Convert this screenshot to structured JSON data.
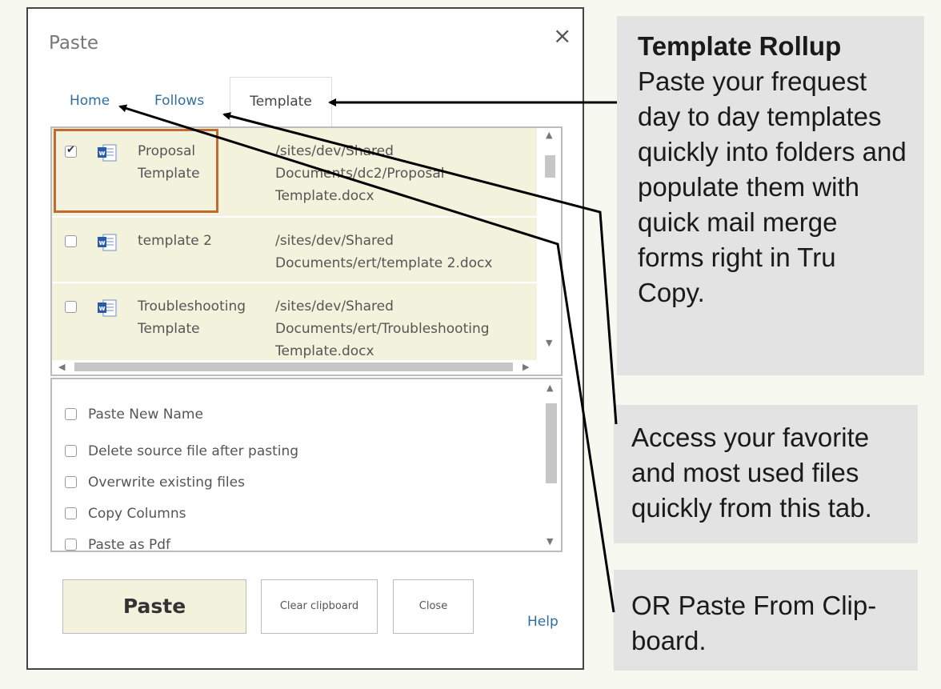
{
  "dialog": {
    "title": "Paste",
    "close_glyph": "×",
    "tabs": [
      {
        "label": "Home"
      },
      {
        "label": "Follows"
      },
      {
        "label": "Template",
        "active": true
      }
    ],
    "files": [
      {
        "name": "Proposal Template",
        "path": "/sites/dev/Shared Documents/dc2/Proposal Template.docx",
        "checked": true,
        "icon": "word-doc-icon"
      },
      {
        "name": "template 2",
        "path": "/sites/dev/Shared Documents/ert/template 2.docx",
        "checked": false,
        "icon": "word-doc-icon"
      },
      {
        "name": "Troubleshooting Template",
        "path": "/sites/dev/Shared Documents/ert/Troubleshooting Template.docx",
        "checked": false,
        "icon": "word-doc-icon"
      }
    ],
    "options": [
      {
        "label": "Paste New Name",
        "checked": false
      },
      {
        "label": "Delete source file after pasting",
        "checked": false
      },
      {
        "label": "Overwrite existing files",
        "checked": false
      },
      {
        "label": "Copy Columns",
        "checked": false
      },
      {
        "label": "Paste as Pdf",
        "checked": false
      }
    ],
    "buttons": {
      "paste": "Paste",
      "clear": "Clear clipboard",
      "close": "Close"
    },
    "help": "Help"
  },
  "callouts": {
    "template_rollup": {
      "title": "Template Rollup",
      "body": "Paste your frequest day to day templates quickly into folders and populate them with quick mail merge forms right in Tru Copy."
    },
    "favorites": "Access your favorite and most used files quickly from this tab.",
    "clipboard": "OR Paste From Clip-board."
  },
  "colors": {
    "row_highlight": "#f3f2dd",
    "link": "#2f6ea5",
    "selection_border": "#c06a30",
    "callout_bg": "#e3e3e3"
  }
}
